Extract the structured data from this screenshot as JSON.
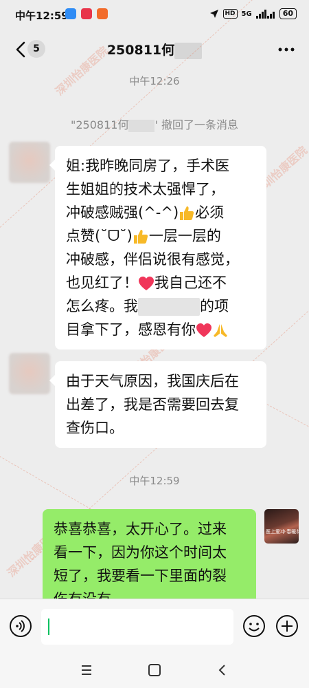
{
  "status_bar": {
    "time": "中午12:59",
    "hd_label": "HD",
    "network": "5G",
    "battery": "60"
  },
  "nav": {
    "unread_count": "5",
    "title": "250811何"
  },
  "messages": {
    "time_1": "中午12:26",
    "recall_prefix": "\"250811何",
    "recall_suffix": "' 撤回了一条消息",
    "msg1": {
      "l1": "姐:我昨晚同房了，手术医",
      "l2": "生姐姐的技术太强悍了，",
      "l3a": "冲破感贼强(^-^)",
      "l3b": "必须",
      "l4a": "点赞(˘ᗜ˘)",
      "l4b": "一层一层的",
      "l5": "冲破感，伴侣说很有感觉，",
      "l6a": "也见红了！",
      "l6b": "我自己还不",
      "l7a": "怎么疼。我",
      "l7b": "的项",
      "l8": "目拿下了，感恩有你"
    },
    "msg2": {
      "l1": "由于天气原因，我国庆后在",
      "l2": "出差了，我是否需要回去复",
      "l3": "查伤口。"
    },
    "time_2": "中午12:59",
    "msg3": {
      "l1": "恭喜恭喜，太开心了。过来",
      "l2": "看一下，因为你这个时间太",
      "l3": "短了，我要看一下里面的裂",
      "l4": "伤有没有"
    },
    "right_avatar_text": "医上爱冲·春暖花开"
  },
  "watermark": {
    "text": "深圳怡康医院",
    "subtext": "SHENZHEN YIKANG HOSPITAL"
  },
  "colors": {
    "background": "#ededed",
    "bubble_received": "#ffffff",
    "bubble_sent": "#95ec69",
    "accent": "#07c160",
    "heart": "#f0365a",
    "thumb": "#f7b928"
  },
  "icons": [
    "back-icon",
    "more-icon",
    "voice-icon",
    "emoji-icon",
    "plus-icon",
    "menu-icon",
    "home-icon",
    "back-nav-icon",
    "thumbs-up-icon",
    "heart-icon",
    "pray-icon",
    "location-arrow-icon",
    "signal-icon"
  ]
}
